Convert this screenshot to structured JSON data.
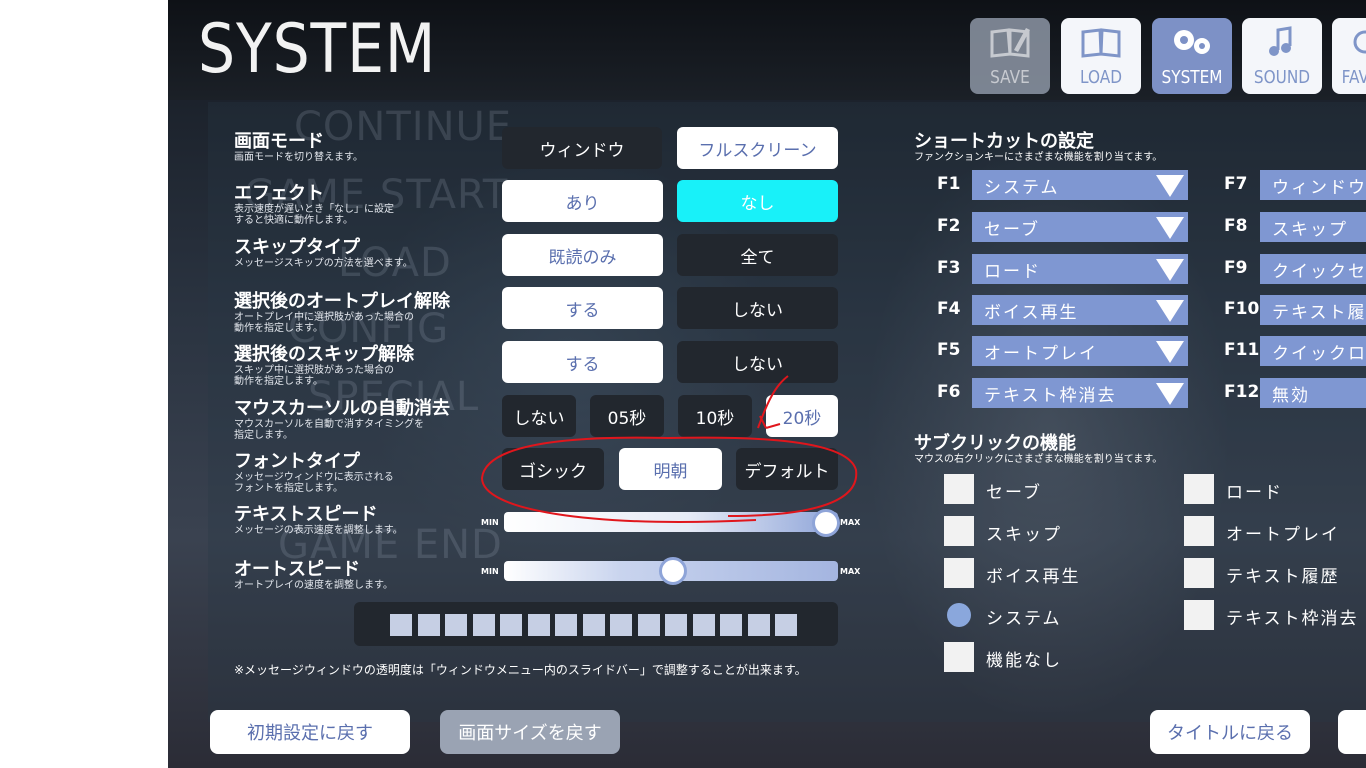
{
  "screen_title": "SYSTEM",
  "background_menu_words": [
    "CONTINUE",
    "GAME START",
    "LOAD",
    "CONFIG",
    "SPECIAL",
    "GAME END"
  ],
  "nav_tabs": [
    {
      "label": "SAVE",
      "icon": "pencil-book-icon",
      "state": "disabled"
    },
    {
      "label": "LOAD",
      "icon": "open-book-icon",
      "state": "normal"
    },
    {
      "label": "SYSTEM",
      "icon": "gears-icon",
      "state": "active"
    },
    {
      "label": "SOUND",
      "icon": "music-note-icon",
      "state": "normal"
    },
    {
      "label": "FAV",
      "icon": "heart-icon",
      "state": "normal"
    }
  ],
  "settings": {
    "screen_mode": {
      "title": "画面モード",
      "desc": "画面モードを切り替えます。",
      "options": [
        "ウィンドウ",
        "フルスクリーン"
      ],
      "selected": "フルスクリーン"
    },
    "effect": {
      "title": "エフェクト",
      "desc": [
        "表示速度が遅いとき「なし」に設定",
        "すると快適に動作します。"
      ],
      "options": [
        "あり",
        "なし"
      ],
      "selected": "なし"
    },
    "skip_type": {
      "title": "スキップタイプ",
      "desc": "メッセージスキップの方法を選べます。",
      "options": [
        "既読のみ",
        "全て"
      ],
      "selected": "既読のみ"
    },
    "autoplay_cancel": {
      "title": "選択後のオートプレイ解除",
      "desc": [
        "オートプレイ中に選択肢があった場合の",
        "動作を指定します。"
      ],
      "options": [
        "する",
        "しない"
      ],
      "selected": "する"
    },
    "skip_cancel": {
      "title": "選択後のスキップ解除",
      "desc": [
        "スキップ中に選択肢があった場合の",
        "動作を指定します。"
      ],
      "options": [
        "する",
        "しない"
      ],
      "selected": "する"
    },
    "cursor_hide": {
      "title": "マウスカーソルの自動消去",
      "desc": [
        "マウスカーソルを自動で消すタイミングを",
        "指定します。"
      ],
      "options": [
        "しない",
        "05秒",
        "10秒",
        "20秒"
      ],
      "selected": "20秒"
    },
    "font_type": {
      "title": "フォントタイプ",
      "desc": [
        "メッセージウィンドウに表示される",
        "フォントを指定します。"
      ],
      "options": [
        "ゴシック",
        "明朝",
        "デフォルト"
      ],
      "selected": "明朝"
    },
    "text_speed": {
      "title": "テキストスピード",
      "desc": "メッセージの表示速度を調整します。",
      "min_label": "MIN",
      "max_label": "MAX",
      "level": 1.0
    },
    "auto_speed": {
      "title": "オートスピード",
      "desc": "オートプレイの速度を調整します。",
      "min_label": "MIN",
      "max_label": "MAX",
      "level": 0.5
    },
    "window_opacity_steps": 15
  },
  "note": "※メッセージウィンドウの透明度は「ウィンドウメニュー内のスライドバー」で調整することが出来ます。",
  "shortcuts": {
    "title": "ショートカットの設定",
    "desc": "ファンクションキーにさまざまな機能を割り当てます。",
    "left": [
      {
        "key": "F1",
        "value": "システム"
      },
      {
        "key": "F2",
        "value": "セーブ"
      },
      {
        "key": "F3",
        "value": "ロード"
      },
      {
        "key": "F4",
        "value": "ボイス再生"
      },
      {
        "key": "F5",
        "value": "オートプレイ"
      },
      {
        "key": "F6",
        "value": "テキスト枠消去"
      }
    ],
    "right": [
      {
        "key": "F7",
        "value": "ウィンドウサイ"
      },
      {
        "key": "F8",
        "value": "スキップ"
      },
      {
        "key": "F9",
        "value": "クイックセ"
      },
      {
        "key": "F10",
        "value": "テキスト履"
      },
      {
        "key": "F11",
        "value": "クイックロ"
      },
      {
        "key": "F12",
        "value": "無効"
      }
    ]
  },
  "subclick": {
    "title": "サブクリックの機能",
    "desc": "マウスの右クリックにさまざまな機能を割り当てます。",
    "left": [
      "セーブ",
      "スキップ",
      "ボイス再生",
      "システム",
      "機能なし"
    ],
    "right": [
      "ロード",
      "オートプレイ",
      "テキスト履歴",
      "テキスト枠消去"
    ],
    "selected": "システム"
  },
  "bottom_buttons": {
    "reset": "初期設定に戻す",
    "screen_size": "画面サイズを戻す",
    "title": "タイトルに戻る"
  },
  "colors": {
    "accent": "#7f97d2",
    "highlight": "#18f1f9",
    "annotation": "#e0161c",
    "selected_text": "#5a6fae"
  }
}
